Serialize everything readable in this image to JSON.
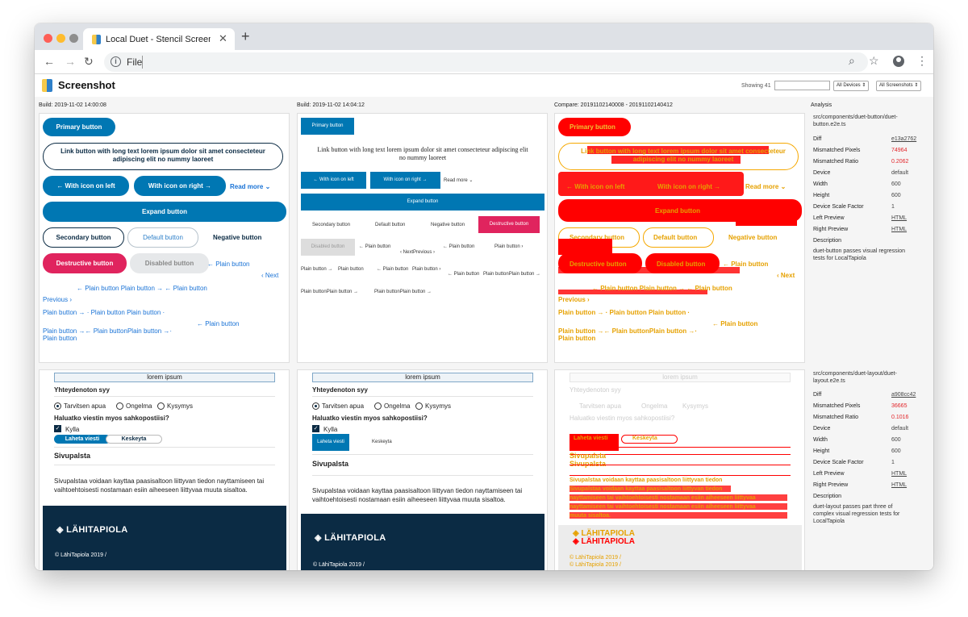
{
  "browser": {
    "tab_title": "Local Duet - Stencil Screenshot",
    "url": "File",
    "new_tab": "+",
    "tab_close": "✕"
  },
  "app": {
    "title": "Screenshot",
    "showing": "Showing 41",
    "filter_value": "",
    "devices_select": "All Devices ⇕",
    "screenshots_select": "All Screenshots ⇕"
  },
  "columns": {
    "left": "Build: 2019-11-02 14:00:08",
    "right": "Build: 2019-11-02 14:04:12",
    "compare": "Compare: 20191102140008 - 20191102140412",
    "analysis": "Analysis"
  },
  "buttons": {
    "primary": "Primary button",
    "long": "Link button with long text lorem ipsum dolor sit amet consecteteur adipiscing elit no nummy laoreet",
    "icon_left": "← With icon on left",
    "icon_right": "With icon on right →",
    "read_more": "Read more ⌄",
    "expand": "Expand button",
    "secondary": "Secondary button",
    "default": "Default button",
    "negative": "Negative button",
    "destructive": "Destructive button",
    "disabled": "Disabled button",
    "plain_left": "← Plain button",
    "next": "‹ Next",
    "previous": "Previous ›",
    "row5": "← Plain button  Plain button → ← Plain button",
    "row6": "Plain button → ·   Plain button  Plain button ·",
    "row7a": "← Plain button",
    "row7b": "Plain button →← Plain buttonPlain button →·",
    "row8": "Plain button",
    "plain_right": "Plain button →",
    "plain": "Plain button",
    "next_prev": "‹ NextPrevious ›",
    "plain_right_chev": "Plain button ›",
    "plainplain": "Plain buttonPlain button →"
  },
  "layout": {
    "header": "lorem ipsum",
    "question": "Yhteydenoton syy",
    "opt1": "Tarvitsen apua",
    "opt2": "Ongelma",
    "opt3": "Kysymys",
    "email_q": "Haluatko viestin myos sahkopostiisi?",
    "yes": "Kylla",
    "send": "Laheta viesti",
    "cancel": "Keskeyta",
    "sidebar_title": "Sivupalsta",
    "sidebar_text": "Sivupalstaa voidaan kayttaa paasisaltoon liittyvan tiedon nayttamiseen tai vaihtoehtoisesti nostamaan esiin aiheeseen liittyvaa muuta sisaltoa.",
    "sidebar_text_l1": "Sivupalstaa voidaan kayttaa paasisaltoon liittyvan tiedon",
    "sidebar_text_l2": "nayttamiseen tai vaihtoehtoisesti nostamaan esiin aiheeseen liittyvaa",
    "sidebar_text_l3": "muuta sisaltoa.",
    "brand": "LÄHITAPIOLA",
    "copyright": "© LähiTapiola 2019  /"
  },
  "analysis": {
    "button": {
      "path": "src/components/duet-button/duet-button.e2e.ts",
      "diff": "e13a2762",
      "mismatched_pixels": "74964",
      "mismatched_ratio": "0.2062",
      "device": "default",
      "width": "600",
      "height": "600",
      "scale": "1",
      "left_preview": "HTML",
      "right_preview": "HTML",
      "description": "duet-button passes visual regression tests for LocalTapiola"
    },
    "layout": {
      "path": "src/components/duet-layout/duet-layout.e2e.ts",
      "diff": "a908cc42",
      "mismatched_pixels": "36665",
      "mismatched_ratio": "0.1016",
      "device": "default",
      "width": "600",
      "height": "600",
      "scale": "1",
      "left_preview": "HTML",
      "right_preview": "HTML",
      "description": "duet-layout passes part three of complex visual regression tests for LocalTapiola"
    },
    "labels": {
      "diff": "Diff",
      "mismatched_pixels": "Mismatched Pixels",
      "mismatched_ratio": "Mismatched Ratio",
      "device": "Device",
      "width": "Width",
      "height": "Height",
      "scale": "Device Scale Factor",
      "left_preview": "Left Preview",
      "right_preview": "Right Preview",
      "description": "Description"
    }
  }
}
